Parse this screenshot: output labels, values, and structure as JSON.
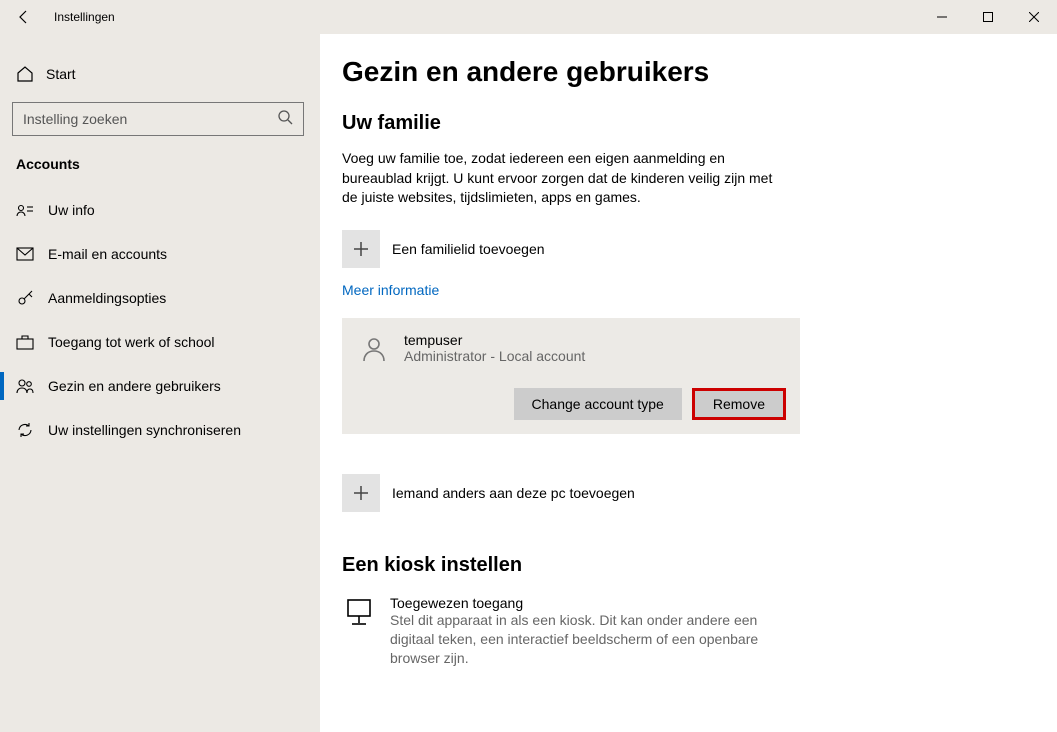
{
  "window": {
    "title": "Instellingen"
  },
  "sidebar": {
    "home_label": "Start",
    "search_placeholder": "Instelling zoeken",
    "section_label": "Accounts",
    "items": [
      {
        "label": "Uw info"
      },
      {
        "label": "E-mail en accounts"
      },
      {
        "label": "Aanmeldingsopties"
      },
      {
        "label": "Toegang tot werk of school"
      },
      {
        "label": "Gezin en andere gebruikers"
      },
      {
        "label": "Uw instellingen synchroniseren"
      }
    ]
  },
  "page": {
    "title": "Gezin en andere gebruikers",
    "family": {
      "heading": "Uw familie",
      "description": "Voeg uw familie toe, zodat iedereen een eigen aanmelding en bureaublad krijgt. U kunt ervoor zorgen dat de kinderen veilig zijn met de juiste websites, tijdslimieten, apps en games.",
      "add_label": "Een familielid toevoegen",
      "more_info": "Meer informatie"
    },
    "user_card": {
      "name": "tempuser",
      "subtitle": "Administrator - Local account",
      "change_button": "Change account type",
      "remove_button": "Remove"
    },
    "other": {
      "add_label": "Iemand anders aan deze pc toevoegen"
    },
    "kiosk": {
      "heading": "Een kiosk instellen",
      "title": "Toegewezen toegang",
      "description": "Stel dit apparaat in als een kiosk. Dit kan onder andere een digitaal teken, een interactief beeldscherm of een openbare browser zijn."
    }
  }
}
